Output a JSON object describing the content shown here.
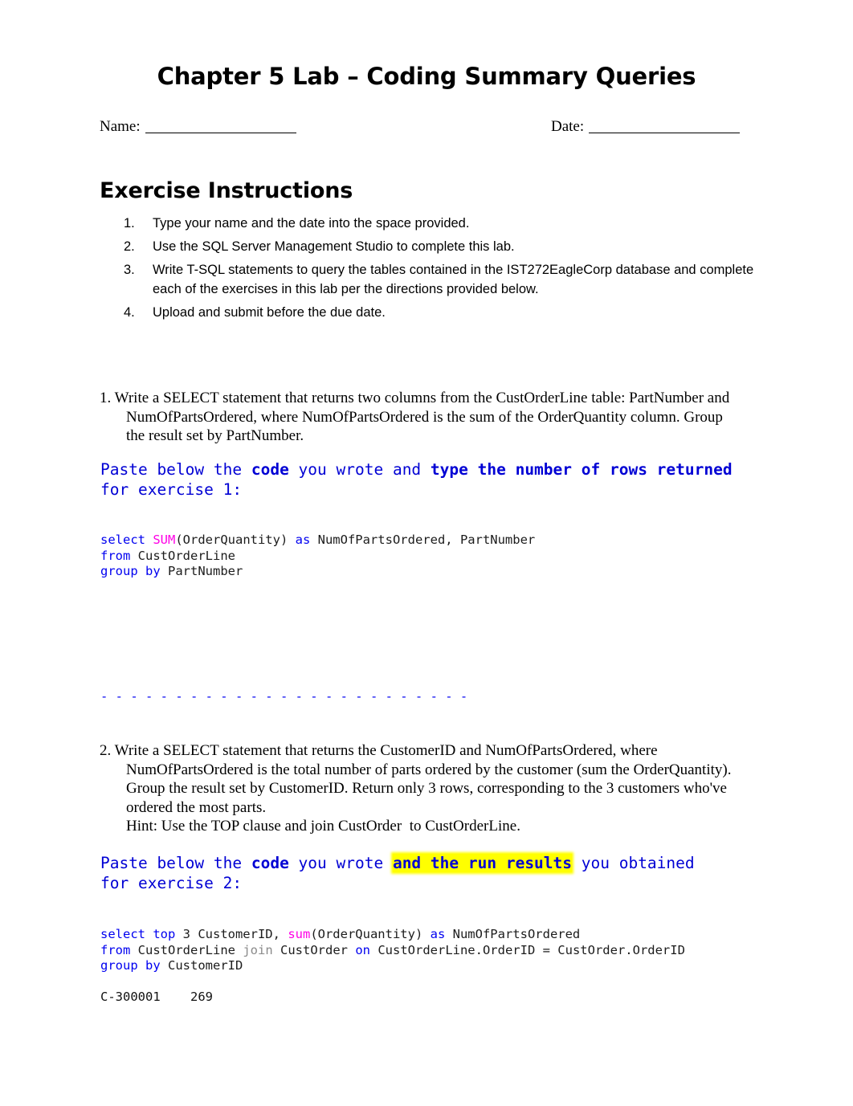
{
  "document": {
    "title": "Chapter 5 Lab – Coding Summary Queries"
  },
  "name_date": {
    "name_label": "Name:",
    "date_label": "Date:"
  },
  "instructions_section": {
    "heading": "Exercise Instructions",
    "items": [
      {
        "number": "1.",
        "text": "Type your name and the date into the space provided."
      },
      {
        "number": "2.",
        "text": "Use the SQL Server Management Studio to complete this lab."
      },
      {
        "number": "3.",
        "text": "Write T-SQL statements to query the tables contained in the IST272EagleCorp database and complete each of the exercises in this lab per the directions provided below."
      },
      {
        "number": "4.",
        "text": "Upload and submit before the due date."
      }
    ]
  },
  "exercise1": {
    "number": "1.",
    "line1": "Write a SELECT statement that returns two columns from the CustOrderLine table: PartNumber and",
    "line2": "NumOfPartsOrdered, where NumOfPartsOrdered is the sum of the OrderQuantity column. Group",
    "line3": "the result set by PartNumber.",
    "note": {
      "p1": "Paste below the ",
      "b1": "code",
      "p2": " you wrote and ",
      "b2": "type the number of rows returned",
      "p3": " for exercise 1:"
    },
    "code": {
      "l1_kw1": "select ",
      "l1_fn": "SUM",
      "l1_id1": "(OrderQuantity) ",
      "l1_kw2": "as ",
      "l1_id2": "NumOfPartsOrdered, PartNumber",
      "l2_kw": "from ",
      "l2_id": "CustOrderLine",
      "l3_kw": "group by ",
      "l3_id": "PartNumber"
    }
  },
  "divider": "- - - - - - - - - - - - - - - - - - - - - - - - -",
  "exercise2": {
    "number": "2.",
    "line1": "Write a SELECT statement that returns the CustomerID and NumOfPartsOrdered, where",
    "line2": "NumOfPartsOrdered is the total number of parts ordered by the customer (sum the OrderQuantity).",
    "line3": "Group the result set by CustomerID. Return only 3 rows, corresponding to the 3 customers who've",
    "line4": "ordered the most parts.",
    "line5": "Hint: Use the TOP clause and join CustOrder  to CustOrderLine.",
    "note": {
      "p1": "Paste below the ",
      "b1": "code",
      "p2": " you wrote ",
      "hl": "and the run results",
      "p3": " you obtained for exercise 2:"
    },
    "code": {
      "l1_kw1": "select top ",
      "l1_id1": "3 CustomerID, ",
      "l1_fn": "sum",
      "l1_id2": "(OrderQuantity) ",
      "l1_kw2": "as ",
      "l1_id3": "NumOfPartsOrdered",
      "l2_kw1": "from ",
      "l2_id1": "CustOrderLine ",
      "l2_join": "join ",
      "l2_id2": "CustOrder ",
      "l2_kw2": "on ",
      "l2_id3": "CustOrderLine.OrderID = CustOrder.OrderID",
      "l3_kw": "group by ",
      "l3_id": "CustomerID"
    }
  },
  "footer": {
    "text": "C-300001    269"
  },
  "colors": {
    "blue_text": "#0000d4",
    "code_keyword": "#0000f0",
    "code_function": "#ff00e6",
    "code_gray": "#8a8a8a",
    "highlight": "#ffff00"
  }
}
